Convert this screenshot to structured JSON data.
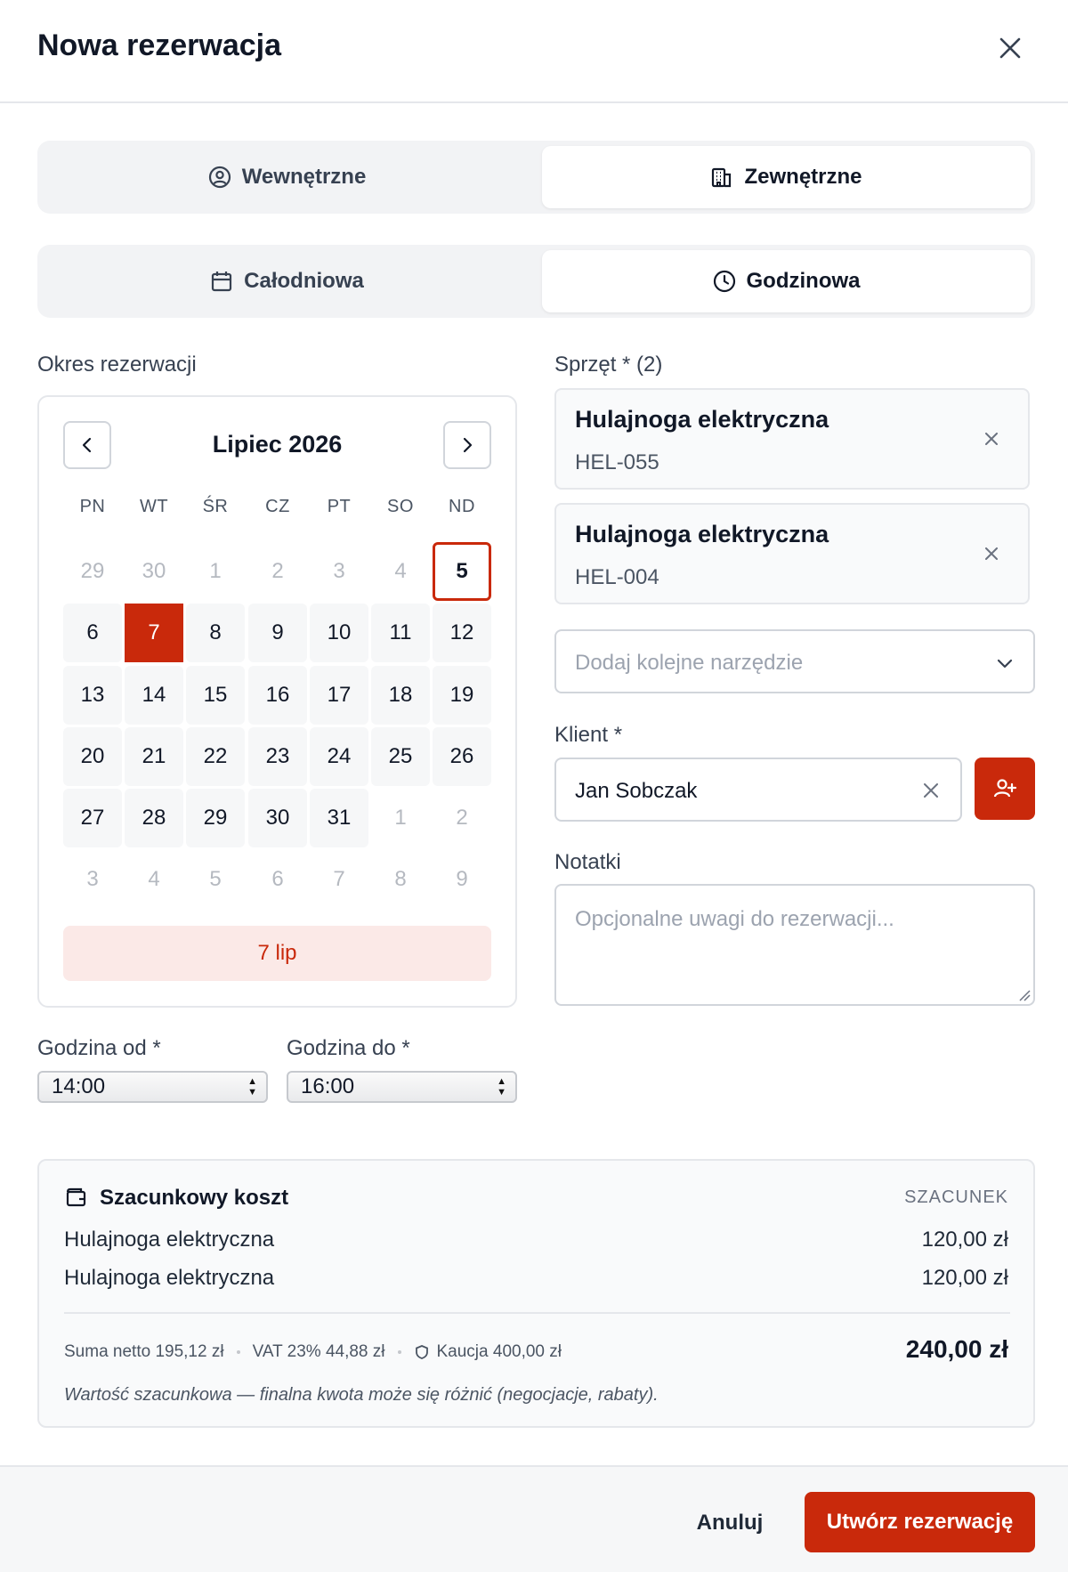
{
  "dialog": {
    "title": "Nowa rezerwacja"
  },
  "audience_toggle": {
    "options": [
      {
        "label": "Wewnętrzne",
        "icon": "user-circle-icon",
        "active": false
      },
      {
        "label": "Zewnętrzne",
        "icon": "building-icon",
        "active": true
      }
    ]
  },
  "duration_toggle": {
    "options": [
      {
        "label": "Całodniowa",
        "icon": "calendar-icon",
        "active": false
      },
      {
        "label": "Godzinowa",
        "icon": "clock-icon",
        "active": true
      }
    ]
  },
  "period": {
    "label": "Okres rezerwacji",
    "calendar": {
      "month_title": "Lipiec 2026",
      "weekdays": [
        "PN",
        "WT",
        "ŚR",
        "CZ",
        "PT",
        "SO",
        "ND"
      ],
      "weeks": [
        [
          "29",
          "30",
          "1",
          "2",
          "3",
          "4",
          "5"
        ],
        [
          "6",
          "7",
          "8",
          "9",
          "10",
          "11",
          "12"
        ],
        [
          "13",
          "14",
          "15",
          "16",
          "17",
          "18",
          "19"
        ],
        [
          "20",
          "21",
          "22",
          "23",
          "24",
          "25",
          "26"
        ],
        [
          "27",
          "28",
          "29",
          "30",
          "31",
          "1",
          "2"
        ],
        [
          "3",
          "4",
          "5",
          "6",
          "7",
          "8",
          "9"
        ]
      ],
      "selected_day": "7",
      "today": "5",
      "selected_label": "7 lip"
    }
  },
  "time": {
    "from": {
      "label": "Godzina od *",
      "value": "14:00"
    },
    "to": {
      "label": "Godzina do *",
      "value": "16:00"
    }
  },
  "equipment": {
    "label": "Sprzęt * (2)",
    "items": [
      {
        "name": "Hulajnoga elektryczna",
        "code": "HEL-055"
      },
      {
        "name": "Hulajnoga elektryczna",
        "code": "HEL-004"
      }
    ],
    "add_placeholder": "Dodaj kolejne narzędzie"
  },
  "client": {
    "label": "Klient *",
    "value": "Jan Sobczak"
  },
  "notes": {
    "label": "Notatki",
    "placeholder": "Opcjonalne uwagi do rezerwacji..."
  },
  "cost": {
    "title": "Szacunkowy koszt",
    "badge": "SZACUNEK",
    "rows": [
      {
        "name": "Hulajnoga elektryczna",
        "price": "120,00 zł"
      },
      {
        "name": "Hulajnoga elektryczna",
        "price": "120,00 zł"
      }
    ],
    "net": "Suma netto 195,12 zł",
    "vat": "VAT 23% 44,88 zł",
    "deposit": "Kaucja 400,00 zł",
    "total": "240,00 zł",
    "note": "Wartość szacunkowa — finalna kwota może się różnić (negocjacje, rabaty)."
  },
  "footer": {
    "cancel_label": "Anuluj",
    "submit_label": "Utwórz rezerwację"
  },
  "colors": {
    "accent": "#c9290b",
    "accent_light": "#fbe9e7"
  }
}
